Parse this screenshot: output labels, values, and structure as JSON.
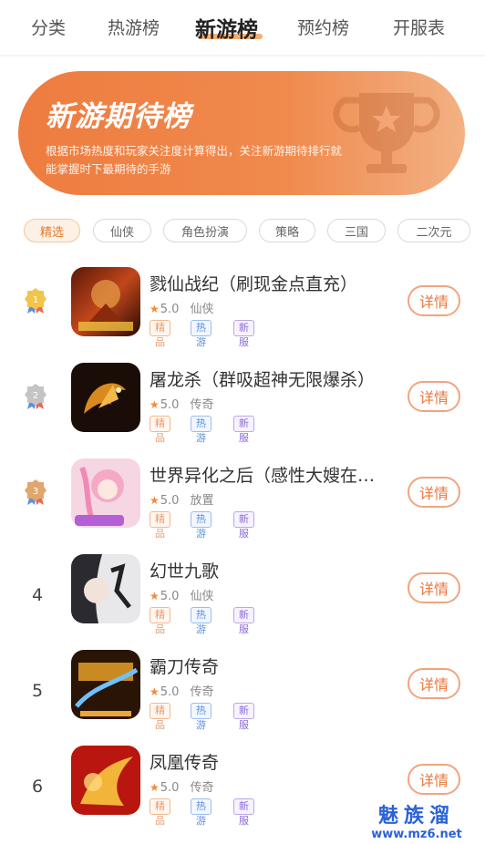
{
  "tabs": [
    "分类",
    "热游榜",
    "新游榜",
    "预约榜",
    "开服表"
  ],
  "banner": {
    "title": "新游期待榜",
    "desc": "根据市场热度和玩家关注度计算得出，关注新游期待排行就能掌握时下最期待的手游"
  },
  "chips": [
    "精选",
    "仙侠",
    "角色扮演",
    "策略",
    "三国",
    "二次元"
  ],
  "games": [
    {
      "rank": "1",
      "name": "戮仙战纪（刷现金点直充）",
      "score": "5.0",
      "genre": "仙侠",
      "tags": [
        "精品",
        "热游",
        "新服"
      ],
      "detail": "详情"
    },
    {
      "rank": "2",
      "name": "屠龙杀（群吸超神无限爆杀）",
      "score": "5.0",
      "genre": "传奇",
      "tags": [
        "精品",
        "热游",
        "新服"
      ],
      "detail": "详情"
    },
    {
      "rank": "3",
      "name": "世界异化之后（感性大嫂在…",
      "score": "5.0",
      "genre": "放置",
      "tags": [
        "精品",
        "热游",
        "新服"
      ],
      "detail": "详情"
    },
    {
      "rank": "4",
      "name": "幻世九歌",
      "score": "5.0",
      "genre": "仙侠",
      "tags": [
        "精品",
        "热游",
        "新服"
      ],
      "detail": "详情"
    },
    {
      "rank": "5",
      "name": "霸刀传奇",
      "score": "5.0",
      "genre": "传奇",
      "tags": [
        "精品",
        "热游",
        "新服"
      ],
      "detail": "详情"
    },
    {
      "rank": "6",
      "name": "凤凰传奇",
      "score": "5.0",
      "genre": "传奇",
      "tags": [
        "精品",
        "热游",
        "新服"
      ],
      "detail": "详情"
    }
  ],
  "watermark": {
    "title": "魅族溜",
    "url": "www.mz6.net"
  },
  "colors": {
    "accent": "#ee7c3f",
    "gold": "#f3c44a",
    "silver": "#c4c4c4",
    "bronze": "#e0a66d",
    "watermark": "#2a62d8"
  }
}
